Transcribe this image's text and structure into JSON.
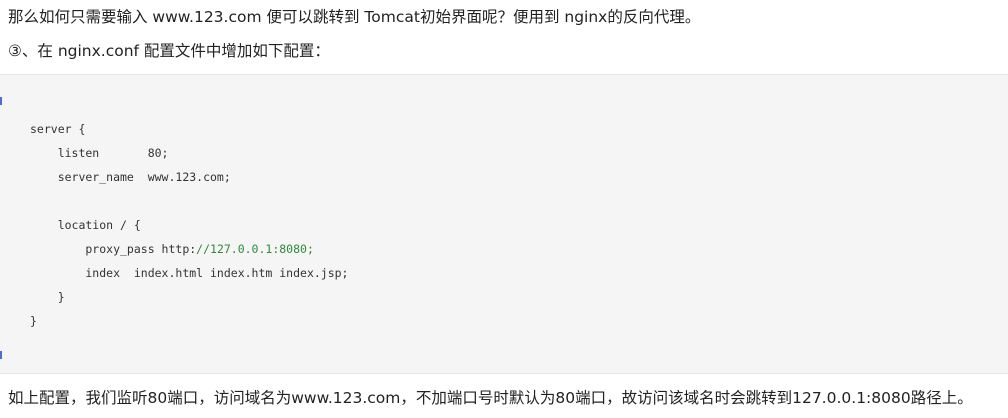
{
  "article": {
    "intro_line": "那么如何只需要输入 www.123.com 便可以跳转到 Tomcat初始界面呢？便用到 nginx的反向代理。",
    "step_line": "③、在 nginx.conf 配置文件中增加如下配置：",
    "code": {
      "l1": "server {",
      "l2": "    listen       80;",
      "l3": "    server_name  www.123.com;",
      "l4": "    location / {",
      "l5_pre": "        proxy_pass http:",
      "l5_url": "//127.0.0.1:8080;",
      "l6": "        index  index.html index.htm index.jsp;",
      "l7": "    }",
      "l8": "}"
    },
    "summary_line": "如上配置，我们监听80端口，访问域名为www.123.com，不加端口号时默认为80端口，故访问该域名时会跳转到127.0.0.1:8080路径上。"
  },
  "colors": {
    "code_background": "#f5f5f5",
    "code_edge_marker": "#4a6fd8",
    "url_string": "#2e8b3a"
  }
}
